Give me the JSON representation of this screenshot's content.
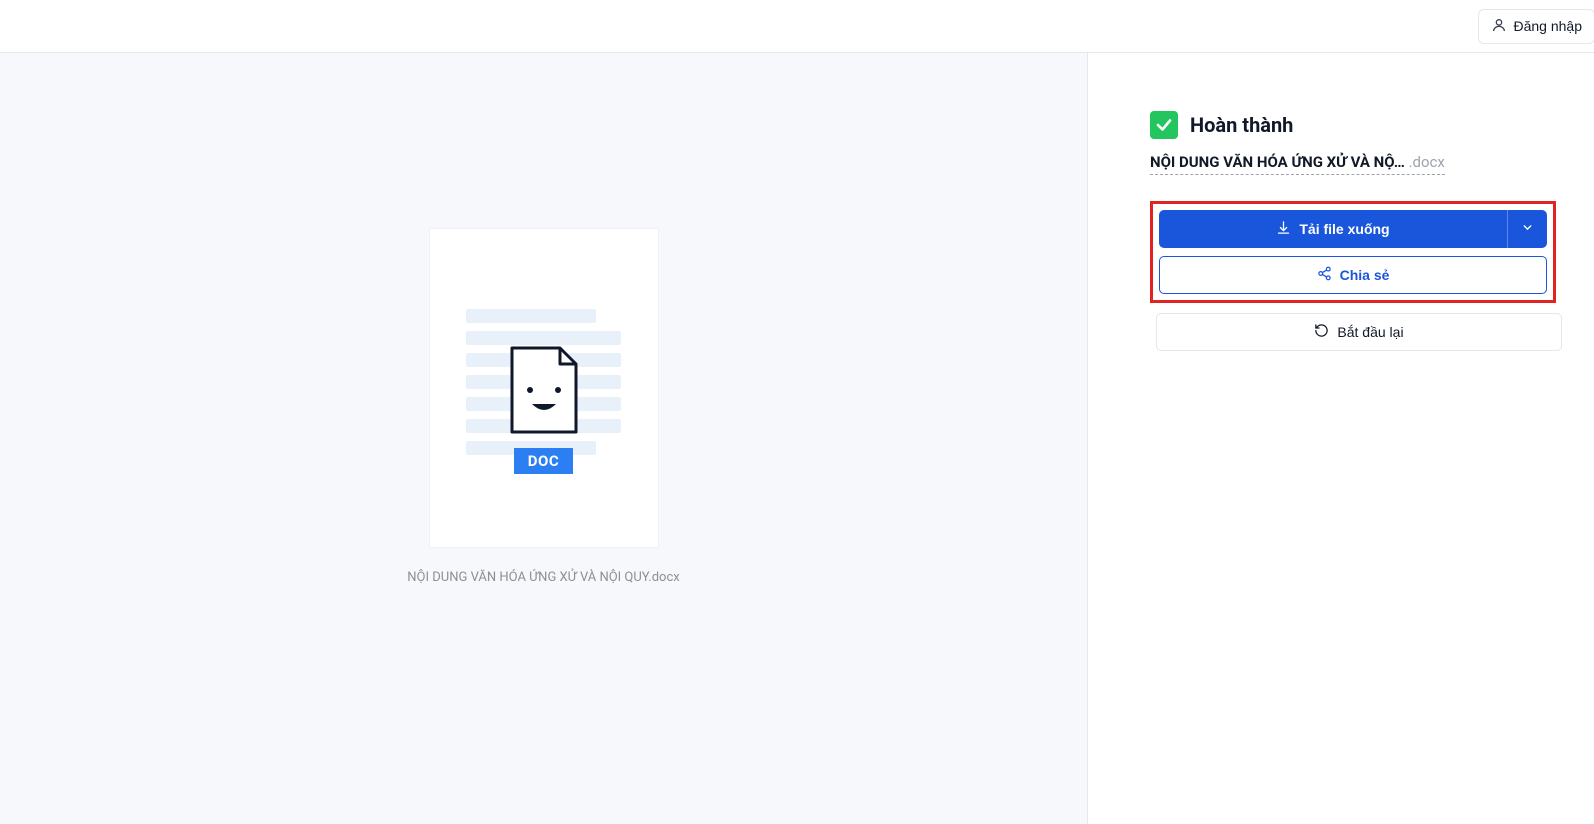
{
  "topbar": {
    "login_label": "Đăng nhập"
  },
  "preview": {
    "badge": "DOC",
    "filename": "NỘI DUNG VĂN HÓA ỨNG XỬ VÀ NỘI QUY.docx"
  },
  "panel": {
    "status": "Hoàn thành",
    "filename_truncated": "NỘI DUNG VĂN HÓA ỨNG XỬ VÀ NỘ…",
    "extension": ".docx",
    "download_label": "Tải file xuống",
    "share_label": "Chia sẻ",
    "restart_label": "Bắt đầu lại"
  }
}
